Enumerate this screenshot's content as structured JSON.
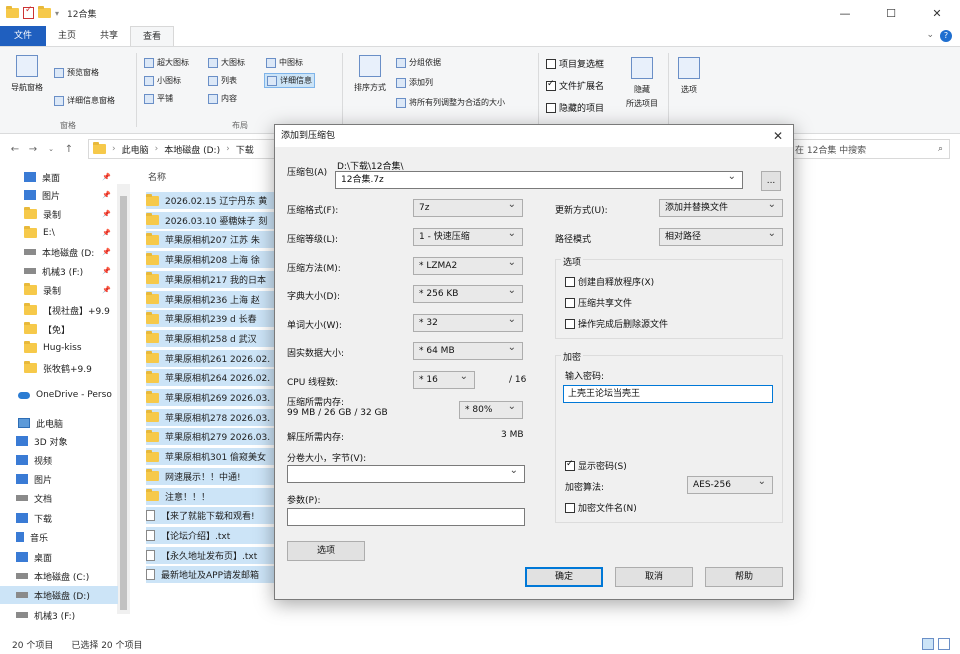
{
  "explorer": {
    "title": "12合集",
    "tabs": [
      "文件",
      "主页",
      "共享",
      "查看"
    ],
    "ribbon": {
      "pane_group": {
        "label": "窗格",
        "nav_pane": "导航窗格",
        "preview_pane": "预览窗格",
        "details_pane": "详细信息窗格"
      },
      "layout_group": {
        "label": "布局",
        "items": [
          "超大图标",
          "大图标",
          "中图标",
          "小图标",
          "列表",
          "详细信息",
          "平铺",
          "内容"
        ]
      },
      "sort_group": {
        "label": "当前视图",
        "sort_by": "排序方式",
        "group_by": "分组依据",
        "add_column": "添加列",
        "fit_columns": "将所有列调整为合适的大小"
      },
      "show_group": {
        "label": "显示/隐藏",
        "item_checkbox": "项目复选框",
        "file_ext": "文件扩展名",
        "hidden_items": "隐藏的项目",
        "hide_selected": "隐藏",
        "hide_selected_sub": "所选项目",
        "options": "选项"
      }
    },
    "address": {
      "crumbs": [
        "此电脑",
        "本地磁盘 (D:)",
        "下载"
      ]
    },
    "search": {
      "placeholder": "在 12合集 中搜索"
    },
    "sidebar": [
      {
        "label": "桌面",
        "icon": "desktop-icon",
        "pinned": true
      },
      {
        "label": "图片",
        "icon": "pictures-icon",
        "pinned": true
      },
      {
        "label": "录制",
        "icon": "folder-icon",
        "pinned": true
      },
      {
        "label": "E:\\",
        "icon": "folder-icon",
        "pinned": true
      },
      {
        "label": "本地磁盘 (D:",
        "icon": "drive-icon",
        "pinned": true
      },
      {
        "label": "机械3 (F:)",
        "icon": "drive-icon",
        "pinned": true
      },
      {
        "label": "录制",
        "icon": "folder-icon",
        "pinned": true
      },
      {
        "label": "【视社盘】+9.9",
        "icon": "folder-icon",
        "pinned": false
      },
      {
        "label": "【免】",
        "icon": "folder-icon",
        "pinned": false
      },
      {
        "label": "Hug-kiss",
        "icon": "folder-icon",
        "pinned": false
      },
      {
        "label": "张牧鹤+9.9",
        "icon": "folder-icon",
        "pinned": false
      },
      {
        "label": "OneDrive - Perso",
        "icon": "onedrive-icon",
        "pinned": false
      },
      {
        "label": "此电脑",
        "icon": "pc-icon",
        "pinned": false
      },
      {
        "label": "3D 对象",
        "icon": "3d-objects-icon",
        "pinned": false
      },
      {
        "label": "视频",
        "icon": "video-icon",
        "pinned": false
      },
      {
        "label": "图片",
        "icon": "pictures-icon",
        "pinned": false
      },
      {
        "label": "文档",
        "icon": "documents-icon",
        "pinned": false
      },
      {
        "label": "下载",
        "icon": "downloads-icon",
        "pinned": false
      },
      {
        "label": "音乐",
        "icon": "music-icon",
        "pinned": false
      },
      {
        "label": "桌面",
        "icon": "desktop-icon",
        "pinned": false
      },
      {
        "label": "本地磁盘 (C:)",
        "icon": "drive-icon",
        "pinned": false
      },
      {
        "label": "本地磁盘 (D:)",
        "icon": "drive-icon",
        "pinned": false,
        "selected": true
      },
      {
        "label": "机械3 (F:)",
        "icon": "drive-icon",
        "pinned": false
      }
    ],
    "filelist": {
      "column_name": "名称",
      "rows": [
        {
          "name": "2026.02.15 辽宁丹东 黄",
          "type": "folder"
        },
        {
          "name": "2026.03.10 鎏糖妹子 刻",
          "type": "folder"
        },
        {
          "name": "苹果原相机207 江苏 朱",
          "type": "folder"
        },
        {
          "name": "苹果原相机208 上海 徐",
          "type": "folder"
        },
        {
          "name": "苹果原相机217 我的日本",
          "type": "folder"
        },
        {
          "name": "苹果原相机236 上海 赵",
          "type": "folder"
        },
        {
          "name": "苹果原相机239 d 长春",
          "type": "folder"
        },
        {
          "name": "苹果原相机258 d 武汉",
          "type": "folder"
        },
        {
          "name": "苹果原相机261 2026.02.",
          "type": "folder"
        },
        {
          "name": "苹果原相机264 2026.02.",
          "type": "folder"
        },
        {
          "name": "苹果原相机269 2026.03.",
          "type": "folder"
        },
        {
          "name": "苹果原相机278 2026.03.",
          "type": "folder"
        },
        {
          "name": "苹果原相机279 2026.03.",
          "type": "folder"
        },
        {
          "name": "苹果原相机301 偷窥美女",
          "type": "folder"
        },
        {
          "name": "网速展示！！中通!",
          "type": "folder"
        },
        {
          "name": "注意！！！",
          "type": "folder"
        },
        {
          "name": "【来了就能下载和观看!",
          "type": "file"
        },
        {
          "name": "【论坛介绍】.txt",
          "type": "file"
        },
        {
          "name": "【永久地址发布页】.txt",
          "type": "file"
        },
        {
          "name": "最新地址及APP请发邮箱",
          "type": "file"
        }
      ]
    },
    "status": {
      "count": "20 个项目",
      "selected": "已选择 20 个项目"
    }
  },
  "dialog": {
    "title": "添加到压缩包",
    "archive_label": "压缩包(A)",
    "archive_path": "D:\\下载\\12合集\\",
    "archive_name": "12合集.7z",
    "browse": "...",
    "format_label": "压缩格式(F):",
    "format_value": "7z",
    "level_label": "压缩等级(L):",
    "level_value": "1 - 快速压缩",
    "method_label": "压缩方法(M):",
    "method_value": "* LZMA2",
    "dict_label": "字典大小(D):",
    "dict_value": "* 256 KB",
    "word_label": "单词大小(W):",
    "word_value": "* 32",
    "solid_label": "固实数据大小:",
    "solid_value": "* 64 MB",
    "threads_label": "CPU 线程数:",
    "threads_value": "* 16",
    "threads_total": "/ 16",
    "mem_label": "压缩所需内存:",
    "mem_detail": "99 MB / 26 GB / 32 GB",
    "mem_value": "* 80%",
    "decomp_label": "解压所需内存:",
    "decomp_value": "3 MB",
    "split_label": "分卷大小，字节(V):",
    "split_value": "",
    "params_label": "参数(P):",
    "params_value": "",
    "options_btn": "选项",
    "update_label": "更新方式(U):",
    "update_value": "添加并替换文件",
    "path_label": "路径模式",
    "path_value": "相对路径",
    "options_group": "选项",
    "opt_sfx": "创建自释放程序(X)",
    "opt_shared": "压缩共享文件",
    "opt_delete": "操作完成后删除源文件",
    "encrypt_group": "加密",
    "password_label": "输入密码:",
    "password_value": "上壳王论坛当壳王",
    "show_password": "显示密码(S)",
    "enc_method_label": "加密算法:",
    "enc_method_value": "AES-256",
    "encrypt_names": "加密文件名(N)",
    "ok": "确定",
    "cancel": "取消",
    "help": "帮助"
  }
}
